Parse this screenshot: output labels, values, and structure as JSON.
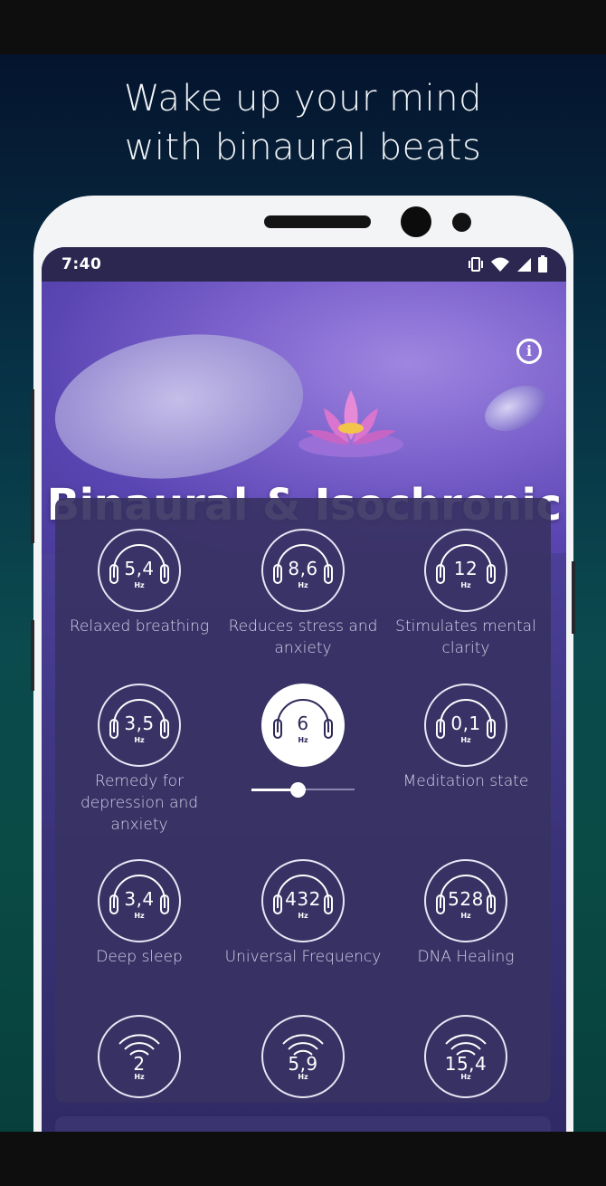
{
  "promo": {
    "headline_line1": "Wake up your mind",
    "headline_line2": "with binaural beats"
  },
  "status_bar": {
    "time": "7:40",
    "icons": [
      "vibrate-icon",
      "wifi-icon",
      "cellular-signal-icon",
      "battery-icon"
    ]
  },
  "app": {
    "title": "Binaural & Isochronic",
    "info_icon": "info-icon"
  },
  "presets": [
    {
      "freq": "5,4",
      "unit": "Hz",
      "label": "Relaxed breathing",
      "icon": "headphones-icon"
    },
    {
      "freq": "8,6",
      "unit": "Hz",
      "label": "Reduces stress and anxiety",
      "icon": "headphones-icon"
    },
    {
      "freq": "12",
      "unit": "Hz",
      "label": "Stimulates mental clarity",
      "icon": "headphones-icon"
    },
    {
      "freq": "3,5",
      "unit": "Hz",
      "label": "Remedy for depression and anxiety",
      "icon": "headphones-icon"
    },
    {
      "freq": "6",
      "unit": "Hz",
      "label": "",
      "icon": "headphones-icon",
      "active": true
    },
    {
      "freq": "0,1",
      "unit": "Hz",
      "label": "Meditation state",
      "icon": "headphones-icon"
    },
    {
      "freq": "3,4",
      "unit": "Hz",
      "label": "Deep sleep",
      "icon": "headphones-icon"
    },
    {
      "freq": "432",
      "unit": "Hz",
      "label": "Universal Frequency",
      "icon": "headphones-icon"
    },
    {
      "freq": "528",
      "unit": "Hz",
      "label": "DNA Healing",
      "icon": "headphones-icon"
    },
    {
      "freq": "2",
      "unit": "Hz",
      "label": "",
      "icon": "signal-waves-icon"
    },
    {
      "freq": "5,9",
      "unit": "Hz",
      "label": "",
      "icon": "signal-waves-icon"
    },
    {
      "freq": "15,4",
      "unit": "Hz",
      "label": "",
      "icon": "signal-waves-icon"
    }
  ],
  "volume_slider": {
    "value": 0.45
  },
  "colors": {
    "accent": "#ffffff",
    "card": "#383263",
    "hero": "#7d63cd"
  }
}
